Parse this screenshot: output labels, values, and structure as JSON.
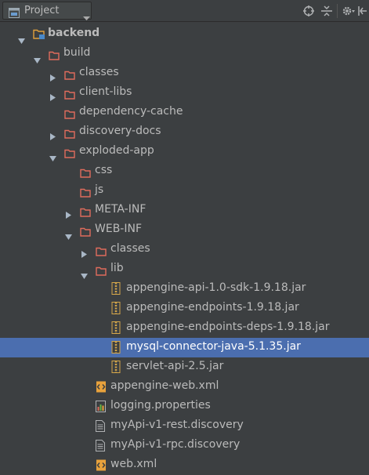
{
  "toolbar": {
    "view_label": "Project",
    "icons": [
      "locate-icon",
      "collapse-all-icon",
      "settings-icon",
      "hide-icon"
    ]
  },
  "colors": {
    "background": "#3c3f41",
    "selection": "#4b6eaf",
    "folder": "#e06c5c",
    "jar": "#d4a64a",
    "text": "#bbbbbb"
  },
  "tree": [
    {
      "label": "backend",
      "depth": 0,
      "icon": "module-folder",
      "expand": "open",
      "bold": true
    },
    {
      "label": "build",
      "depth": 1,
      "icon": "folder",
      "expand": "open"
    },
    {
      "label": "classes",
      "depth": 2,
      "icon": "folder",
      "expand": "closed"
    },
    {
      "label": "client-libs",
      "depth": 2,
      "icon": "folder",
      "expand": "closed"
    },
    {
      "label": "dependency-cache",
      "depth": 2,
      "icon": "folder",
      "expand": "none"
    },
    {
      "label": "discovery-docs",
      "depth": 2,
      "icon": "folder",
      "expand": "closed"
    },
    {
      "label": "exploded-app",
      "depth": 2,
      "icon": "folder",
      "expand": "open"
    },
    {
      "label": "css",
      "depth": 3,
      "icon": "folder",
      "expand": "none"
    },
    {
      "label": "js",
      "depth": 3,
      "icon": "folder",
      "expand": "none"
    },
    {
      "label": "META-INF",
      "depth": 3,
      "icon": "folder",
      "expand": "closed"
    },
    {
      "label": "WEB-INF",
      "depth": 3,
      "icon": "folder",
      "expand": "open"
    },
    {
      "label": "classes",
      "depth": 4,
      "icon": "folder",
      "expand": "closed"
    },
    {
      "label": "lib",
      "depth": 4,
      "icon": "folder",
      "expand": "open"
    },
    {
      "label": "appengine-api-1.0-sdk-1.9.18.jar",
      "depth": 5,
      "icon": "jar",
      "expand": "none"
    },
    {
      "label": "appengine-endpoints-1.9.18.jar",
      "depth": 5,
      "icon": "jar",
      "expand": "none"
    },
    {
      "label": "appengine-endpoints-deps-1.9.18.jar",
      "depth": 5,
      "icon": "jar",
      "expand": "none"
    },
    {
      "label": "mysql-connector-java-5.1.35.jar",
      "depth": 5,
      "icon": "jar",
      "expand": "none",
      "selected": true
    },
    {
      "label": "servlet-api-2.5.jar",
      "depth": 5,
      "icon": "jar",
      "expand": "none"
    },
    {
      "label": "appengine-web.xml",
      "depth": 4,
      "icon": "xml",
      "expand": "none"
    },
    {
      "label": "logging.properties",
      "depth": 4,
      "icon": "properties",
      "expand": "none"
    },
    {
      "label": "myApi-v1-rest.discovery",
      "depth": 4,
      "icon": "text-file",
      "expand": "none"
    },
    {
      "label": "myApi-v1-rpc.discovery",
      "depth": 4,
      "icon": "text-file",
      "expand": "none"
    },
    {
      "label": "web.xml",
      "depth": 4,
      "icon": "xml",
      "expand": "none"
    }
  ]
}
